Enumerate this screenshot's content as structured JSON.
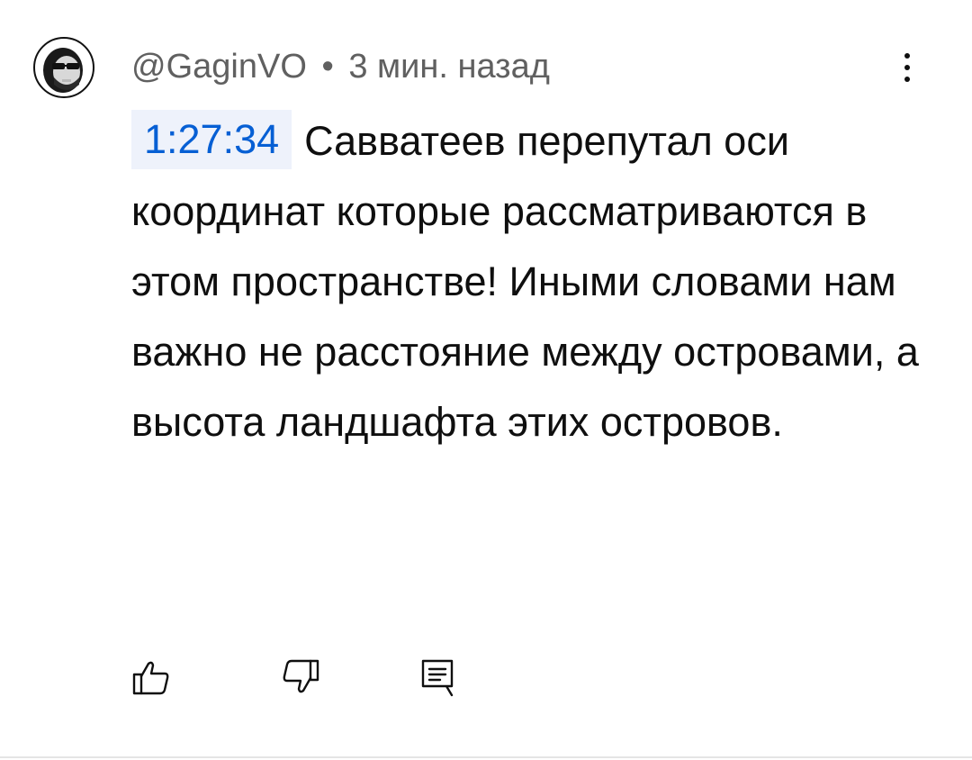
{
  "comment": {
    "author": "@GaginVO",
    "separator": "•",
    "time_ago": "3 мин. назад",
    "timestamp_link": "1:27:34",
    "text": "Савватеев перепутал оси координат которые рассматриваются в этом пространстве! Иными словами нам важно не расстояние между островами, а высота ландшафта этих островов.",
    "accent_color": "#065fd4",
    "timestamp_bg": "#eef2fb"
  },
  "icons": {
    "avatar": "user-avatar",
    "menu": "more-vert-icon",
    "like": "thumbs-up-icon",
    "dislike": "thumbs-down-icon",
    "reply": "reply-comment-icon"
  }
}
